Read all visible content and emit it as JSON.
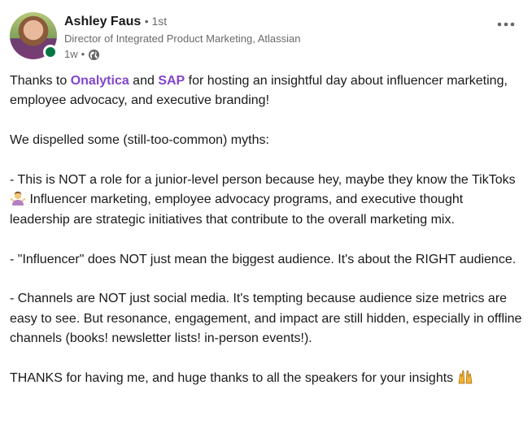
{
  "post": {
    "author": {
      "name": "Ashley Faus",
      "degree": "1st",
      "headline": "Director of Integrated Product Marketing, Atlassian",
      "time": "1w",
      "visibility_icon": "globe-icon",
      "online": true
    },
    "more_icon": "ellipsis-horizontal-icon",
    "accent_color": "#8344cc",
    "paragraphs": {
      "p1": {
        "prefix": "Thanks to ",
        "mention1": "Onalytica",
        "mid": " and ",
        "mention2": "SAP",
        "suffix": " for hosting an insightful day about influencer marketing, employee advocacy, and executive branding!"
      },
      "p2": "We dispelled some (still-too-common) myths:",
      "p3": {
        "before_emoji": "- This is NOT a role for a junior-level person because hey, maybe they know the TikToks",
        "emoji_icon": "person-shrugging-icon",
        "after_emoji": " Influencer marketing, employee advocacy programs, and executive thought leadership are strategic initiatives that contribute to the overall marketing mix."
      },
      "p4": "- \"Influencer\" does NOT just mean the biggest audience. It's about the RIGHT audience.",
      "p5": "- Channels are NOT just social media. It's tempting because audience size metrics are easy to see. But resonance, engagement, and impact are still hidden, especially in offline channels (books! newsletter lists! in-person events!).",
      "p6": {
        "text": "THANKS for having me, and huge thanks to all the speakers for your insights ",
        "emoji_icon": "raising-hands-icon"
      }
    }
  }
}
